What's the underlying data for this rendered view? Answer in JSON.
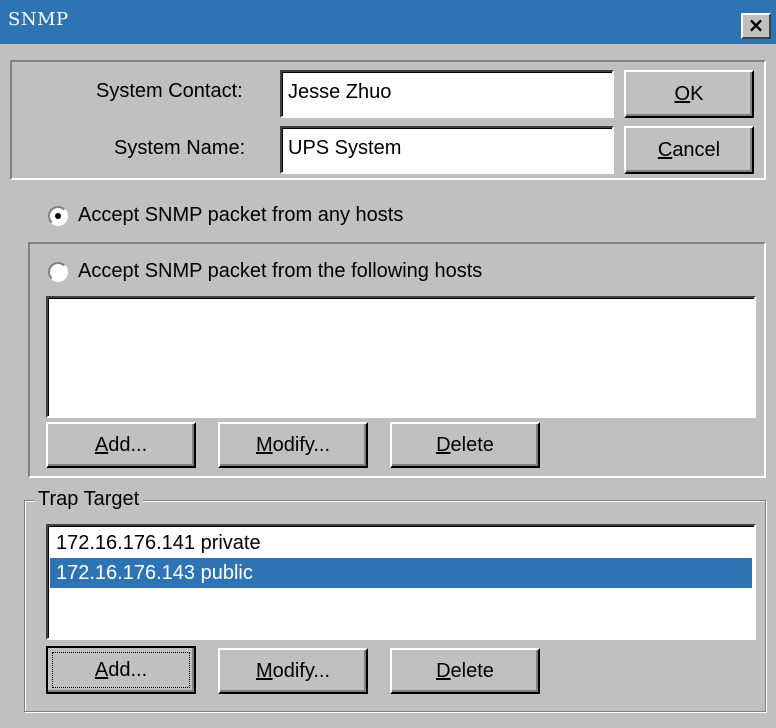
{
  "window": {
    "title": "SNMP",
    "close_glyph": "×"
  },
  "system": {
    "contact_label": "System Contact:",
    "contact_value": "Jesse Zhuo",
    "name_label": "System Name:",
    "name_value": "UPS System"
  },
  "dialog_buttons": {
    "ok": {
      "accel": "O",
      "rest": "K"
    },
    "cancel": {
      "accel": "C",
      "rest": "ancel"
    }
  },
  "access": {
    "any_hosts_label": "Accept SNMP packet from any hosts",
    "any_hosts_selected": true,
    "following_hosts_label": "Accept SNMP packet from the following hosts",
    "following_hosts_selected": false,
    "hosts": [],
    "buttons": {
      "add": {
        "accel": "A",
        "rest": "dd..."
      },
      "modify": {
        "accel": "M",
        "rest": "odify..."
      },
      "delete": {
        "accel": "D",
        "rest": "elete"
      }
    }
  },
  "trap": {
    "legend": "Trap Target",
    "targets": [
      {
        "text": "172.16.176.141 private",
        "selected": false
      },
      {
        "text": "172.16.176.143 public",
        "selected": true
      }
    ],
    "buttons": {
      "add": {
        "accel": "A",
        "rest": "dd..."
      },
      "modify": {
        "accel": "M",
        "rest": "odify..."
      },
      "delete": {
        "accel": "D",
        "rest": "elete"
      }
    }
  },
  "colors": {
    "titlebar": "#2e74b5",
    "selection": "#2e74b5",
    "face": "#c0c0c0"
  },
  "icons": {
    "close": "close-icon"
  }
}
